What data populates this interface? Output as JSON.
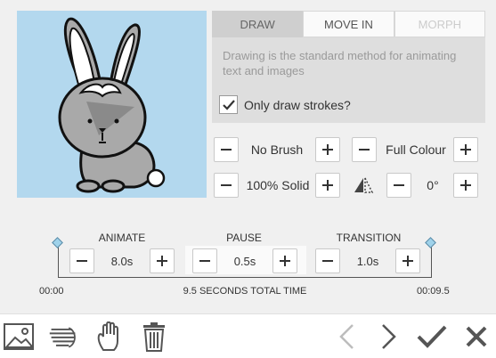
{
  "tabs": [
    {
      "label": "DRAW",
      "state": "active"
    },
    {
      "label": "MOVE IN",
      "state": "normal"
    },
    {
      "label": "MORPH",
      "state": "disabled"
    }
  ],
  "draw_info": {
    "description": "Drawing is the standard method for animating text and images",
    "checkbox_label": "Only draw strokes?",
    "checkbox_checked": true
  },
  "controls": {
    "brush": "No Brush",
    "colour": "Full Colour",
    "solid": "100% Solid",
    "angle": "0°"
  },
  "timeline": {
    "animate_label": "ANIMATE",
    "animate_value": "8.0s",
    "pause_label": "PAUSE",
    "pause_value": "0.5s",
    "transition_label": "TRANSITION",
    "transition_value": "1.0s",
    "start_time": "00:00",
    "end_time": "00:09.5",
    "total": "9.5 SECONDS TOTAL TIME"
  },
  "icons": {
    "bottom_left": [
      "image-icon",
      "text-lines-icon",
      "hand-icon",
      "trash-icon"
    ],
    "bottom_right": [
      "back-arrow-icon",
      "forward-arrow-icon",
      "check-icon",
      "close-icon"
    ]
  },
  "colors": {
    "preview_bg": "#b3d8ee",
    "panel_bg": "#dedede",
    "active_tab": "#cfcfcf",
    "diamond": "#9fd2ea"
  }
}
